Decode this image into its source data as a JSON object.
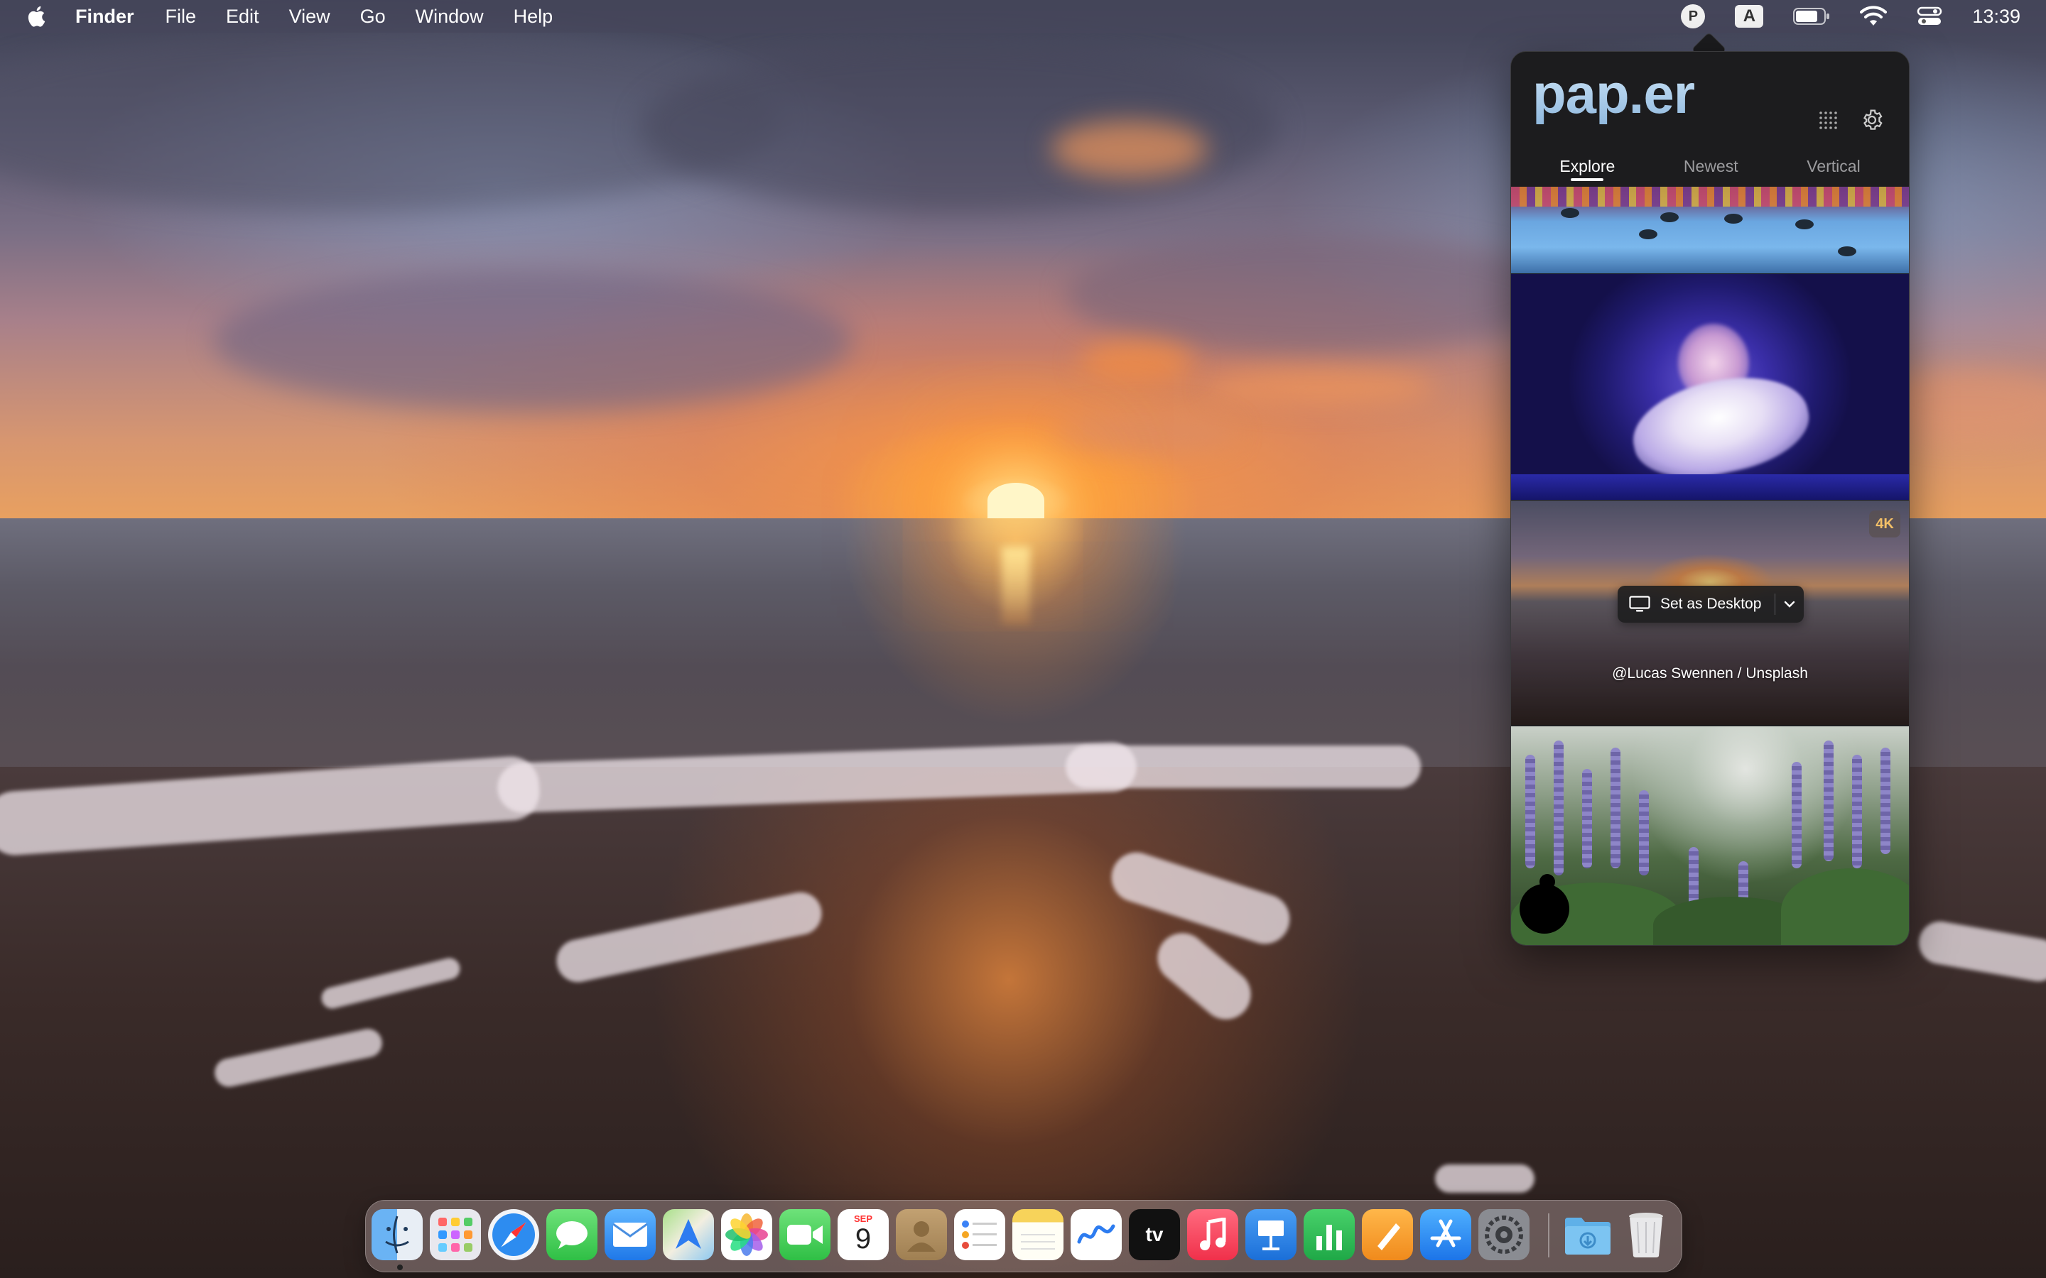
{
  "menubar": {
    "app_name": "Finder",
    "menus": [
      "File",
      "Edit",
      "View",
      "Go",
      "Window",
      "Help"
    ],
    "status": {
      "paper_icon_letter": "P",
      "input_source_letter": "A",
      "clock": "13:39"
    }
  },
  "popover": {
    "logo": "pap.er",
    "tabs": [
      "Explore",
      "Newest",
      "Vertical"
    ],
    "active_tab": "Explore",
    "thumbnail_3": {
      "badge": "4K",
      "set_desktop_label": "Set as Desktop",
      "credit": "@Lucas Swennen / Unsplash"
    }
  },
  "dock": {
    "apps": [
      "finder-icon",
      "launchpad-icon",
      "safari-icon",
      "messages-icon",
      "mail-icon",
      "maps-icon",
      "photos-icon",
      "facetime-icon",
      "calendar-icon",
      "contacts-icon",
      "reminders-icon",
      "notes-icon",
      "freeform-icon",
      "tv-icon",
      "music-icon",
      "keynote-icon",
      "numbers-icon",
      "pages-icon",
      "app-store-icon",
      "system-settings-icon",
      "downloads-folder-icon",
      "trash-icon"
    ],
    "calendar": {
      "month": "SEP",
      "day": "9"
    },
    "tv_label": "tv"
  },
  "colors": {
    "menubar_bg": "#464660",
    "popover_bg": "#1c1c1e",
    "logo_color": "#9fc6e8",
    "badge_4k": "#f4c067"
  }
}
